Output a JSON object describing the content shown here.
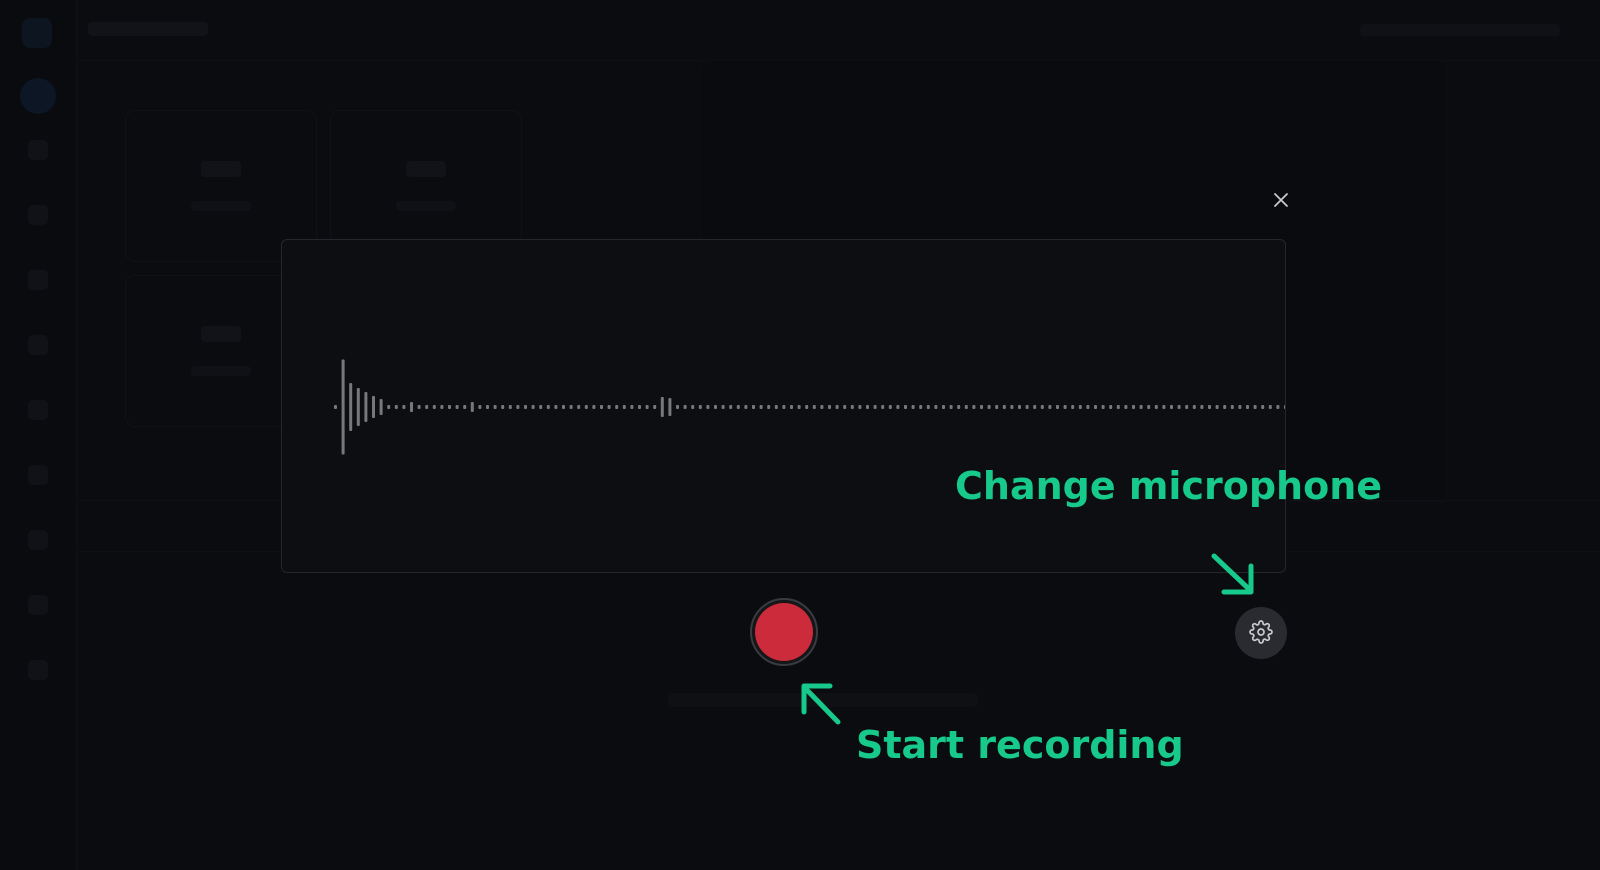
{
  "annotations": {
    "change_mic": "Change microphone",
    "start_recording": "Start recording"
  },
  "icons": {
    "close": "close-icon",
    "settings": "gear-icon",
    "record": "record-icon"
  },
  "colors": {
    "accent": "#17c98a",
    "record": "#cc2b3b",
    "waveform": "#77787c"
  },
  "waveform": {
    "bars": [
      0.04,
      0.95,
      0.48,
      0.38,
      0.3,
      0.22,
      0.16,
      0.04,
      0.04,
      0.04,
      0.1,
      0.04,
      0.04,
      0.04,
      0.04,
      0.04,
      0.04,
      0.04,
      0.1,
      0.04,
      0.04,
      0.04,
      0.04,
      0.04,
      0.04,
      0.04,
      0.04,
      0.04,
      0.04,
      0.04,
      0.04,
      0.04,
      0.04,
      0.04,
      0.04,
      0.04,
      0.04,
      0.04,
      0.04,
      0.04,
      0.04,
      0.04,
      0.04,
      0.2,
      0.18,
      0.04,
      0.04,
      0.04,
      0.04,
      0.04,
      0.04,
      0.04,
      0.04,
      0.04,
      0.04,
      0.04,
      0.04,
      0.04,
      0.04,
      0.04,
      0.04,
      0.04,
      0.04,
      0.04,
      0.04,
      0.04,
      0.04,
      0.04,
      0.04,
      0.04,
      0.04,
      0.04,
      0.04,
      0.04,
      0.04,
      0.04,
      0.04,
      0.04,
      0.04,
      0.04,
      0.04,
      0.04,
      0.04,
      0.04,
      0.04,
      0.04,
      0.04,
      0.04,
      0.04,
      0.04,
      0.04,
      0.04,
      0.04,
      0.04,
      0.04,
      0.04,
      0.04,
      0.04,
      0.04,
      0.04,
      0.04,
      0.04,
      0.04,
      0.04,
      0.04,
      0.04,
      0.04,
      0.04,
      0.04,
      0.04,
      0.04,
      0.04,
      0.04,
      0.04,
      0.04,
      0.04,
      0.04,
      0.04,
      0.04,
      0.04,
      0.04,
      0.04,
      0.04,
      0.04,
      0.04,
      0.04,
      0.04,
      0.04,
      0.04,
      0.04,
      0.04,
      0.04,
      0.04
    ]
  }
}
